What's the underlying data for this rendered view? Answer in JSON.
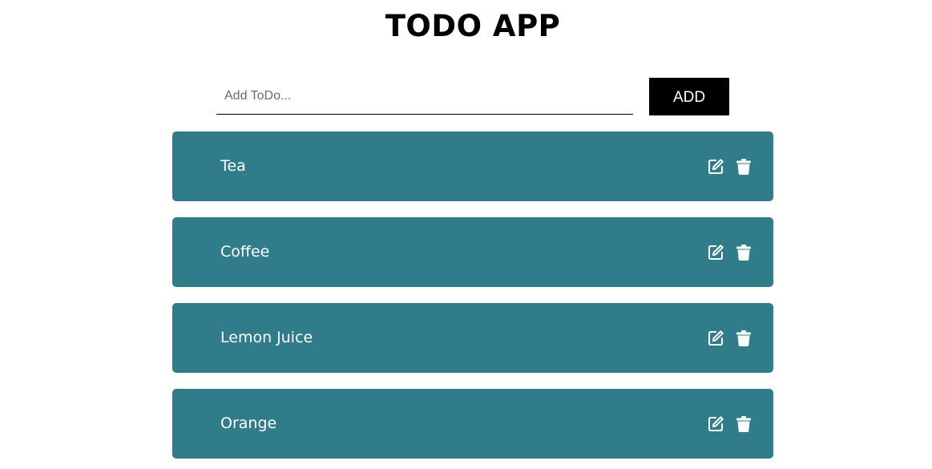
{
  "app": {
    "title": "TODO APP"
  },
  "add_form": {
    "placeholder": "Add ToDo...",
    "value": "",
    "button_label": "ADD"
  },
  "todos": [
    {
      "text": "Tea",
      "edit_icon": "edit-icon",
      "delete_icon": "trash-icon"
    },
    {
      "text": "Coffee",
      "edit_icon": "edit-icon",
      "delete_icon": "trash-icon"
    },
    {
      "text": "Lemon Juice",
      "edit_icon": "edit-icon",
      "delete_icon": "trash-icon"
    },
    {
      "text": "Orange",
      "edit_icon": "edit-icon",
      "delete_icon": "trash-icon"
    }
  ],
  "colors": {
    "item_background": "#317c8a",
    "item_text": "#ffffff",
    "add_button_background": "#000000",
    "add_button_text": "#ffffff"
  }
}
